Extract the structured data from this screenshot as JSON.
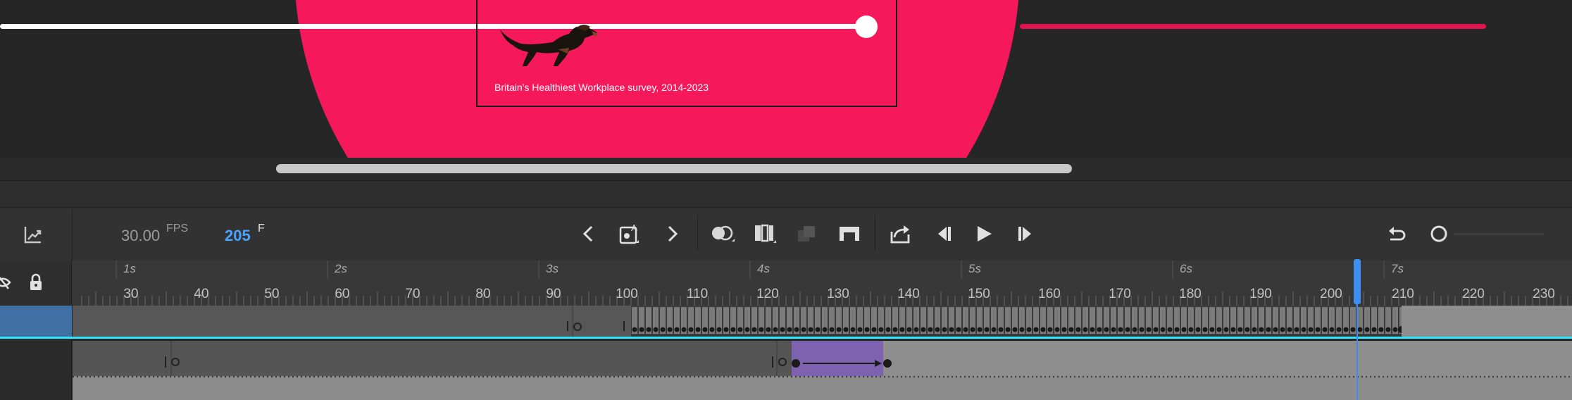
{
  "stage": {
    "caption": "Britain's Healthiest Workplace survey, 2014-2023",
    "accent_color": "#f5195c",
    "image": "dachshund-image"
  },
  "toolbar": {
    "fps_value": "30.00",
    "fps_unit": "FPS",
    "frame_value": "205",
    "frame_unit": "F",
    "icons": [
      "graph-icon",
      "prev-keyframe-icon",
      "insert-keyframe-icon",
      "next-keyframe-icon",
      "onion-skin-icon",
      "edit-multiple-frames-icon",
      "paste-frames-icon",
      "loop-icon",
      "export-icon",
      "step-back-icon",
      "play-icon",
      "step-forward-icon",
      "undo-icon",
      "zoom-knob-icon"
    ]
  },
  "ruler": {
    "seconds": [
      "1s",
      "2s",
      "3s",
      "4s",
      "5s",
      "6s",
      "7s"
    ],
    "frames": [
      "30",
      "40",
      "50",
      "60",
      "70",
      "80",
      "90",
      "100",
      "110",
      "120",
      "130",
      "140",
      "150",
      "160",
      "170",
      "180",
      "190",
      "200",
      "210",
      "220",
      "230"
    ]
  },
  "timeline": {
    "current_frame": 205,
    "playhead_color": "#3b8ef0",
    "tween_color": "#7e62b0"
  }
}
